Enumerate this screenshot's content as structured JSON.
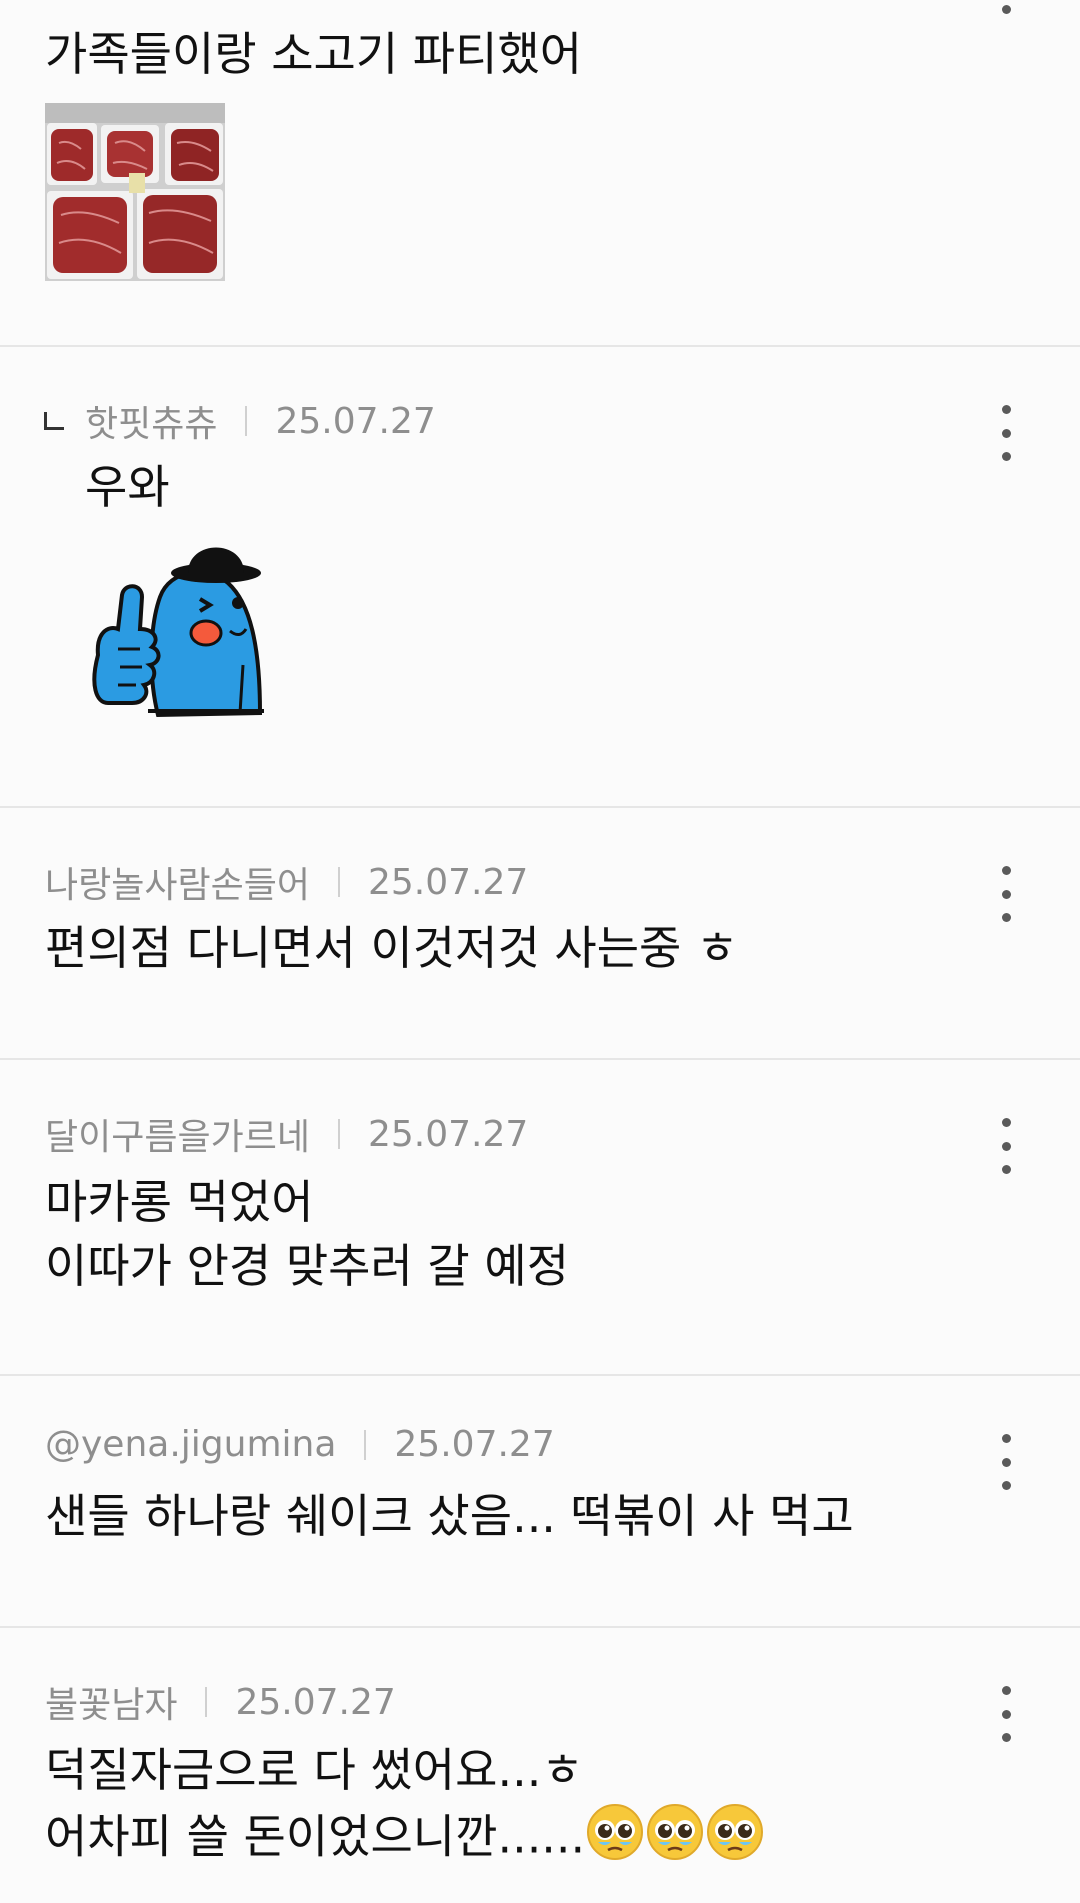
{
  "comments": [
    {
      "text": "가족들이랑 소고기 파티했어",
      "image": "beef-packs-photo"
    },
    {
      "reply": true,
      "author": "핫핏츄츄",
      "date": "25.07.27",
      "text": "우와",
      "sticker": "blue-character-thumbs-up-sticker"
    },
    {
      "author": "나랑놀사람손들어",
      "date": "25.07.27",
      "text": "편의점 다니면서 이것저것 사는중 ㅎ"
    },
    {
      "author": "달이구름을가르네",
      "date": "25.07.27",
      "lines": [
        "마카롱 먹었어",
        "이따가 안경 맞추러 갈 예정"
      ]
    },
    {
      "author": "@yena.jigumina",
      "date": "25.07.27",
      "text": "샌들 하나랑 쉐이크 샀음... 떡볶이 사 먹고"
    },
    {
      "author": "불꽃남자",
      "date": "25.07.27",
      "lines": [
        "덕질자금으로 다 썼어요...ㅎ",
        "어차피 쓸 돈이었으니깐......"
      ],
      "trailing_emoji": [
        "pleading-face-emoji",
        "pleading-face-emoji",
        "pleading-face-emoji"
      ]
    }
  ]
}
